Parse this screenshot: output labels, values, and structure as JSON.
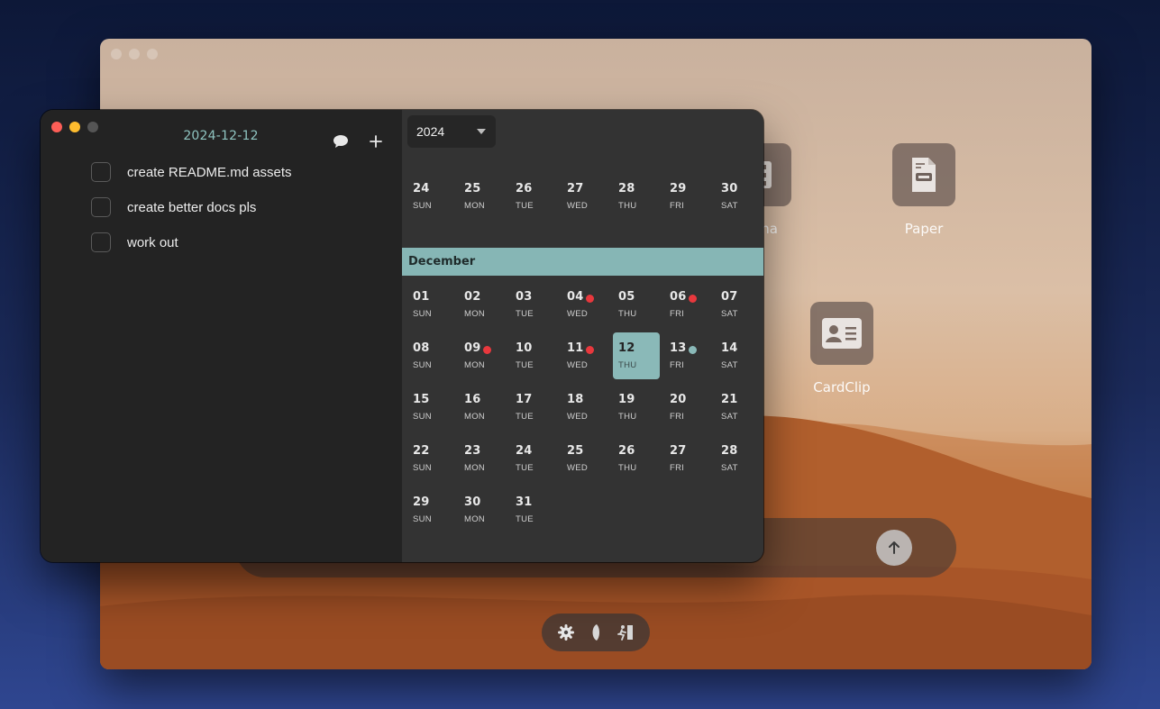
{
  "desktop": {
    "apps": [
      {
        "name": "Cinema",
        "label": "ma",
        "icon": "film-icon"
      },
      {
        "name": "Paper",
        "label": "Paper",
        "icon": "document-icon"
      },
      {
        "name": "CardClip",
        "label": "CardClip",
        "icon": "contact-card-icon"
      }
    ],
    "dock": [
      "gear-icon",
      "moon-icon",
      "exit-icon"
    ],
    "send_icon": "arrow-up-icon"
  },
  "todo": {
    "date": "2024-12-12",
    "items": [
      {
        "text": "create README.md assets",
        "done": false
      },
      {
        "text": "create better docs pls",
        "done": false
      },
      {
        "text": "work out",
        "done": false
      }
    ]
  },
  "calendar": {
    "year": "2024",
    "prev_week": [
      {
        "num": "24",
        "wd": "SUN"
      },
      {
        "num": "25",
        "wd": "MON"
      },
      {
        "num": "26",
        "wd": "TUE"
      },
      {
        "num": "27",
        "wd": "WED"
      },
      {
        "num": "28",
        "wd": "THU"
      },
      {
        "num": "29",
        "wd": "FRI"
      },
      {
        "num": "30",
        "wd": "SAT"
      }
    ],
    "month": "December",
    "weeks": [
      [
        {
          "num": "01",
          "wd": "SUN"
        },
        {
          "num": "02",
          "wd": "MON"
        },
        {
          "num": "03",
          "wd": "TUE"
        },
        {
          "num": "04",
          "wd": "WED",
          "dot": "#e8383d"
        },
        {
          "num": "05",
          "wd": "THU"
        },
        {
          "num": "06",
          "wd": "FRI",
          "dot": "#e8383d"
        },
        {
          "num": "07",
          "wd": "SAT"
        }
      ],
      [
        {
          "num": "08",
          "wd": "SUN"
        },
        {
          "num": "09",
          "wd": "MON",
          "dot": "#e8383d"
        },
        {
          "num": "10",
          "wd": "TUE"
        },
        {
          "num": "11",
          "wd": "WED",
          "dot": "#e8383d"
        },
        {
          "num": "12",
          "wd": "THU",
          "selected": true
        },
        {
          "num": "13",
          "wd": "FRI",
          "dot": "#8ab9b8"
        },
        {
          "num": "14",
          "wd": "SAT"
        }
      ],
      [
        {
          "num": "15",
          "wd": "SUN"
        },
        {
          "num": "16",
          "wd": "MON"
        },
        {
          "num": "17",
          "wd": "TUE"
        },
        {
          "num": "18",
          "wd": "WED"
        },
        {
          "num": "19",
          "wd": "THU"
        },
        {
          "num": "20",
          "wd": "FRI"
        },
        {
          "num": "21",
          "wd": "SAT"
        }
      ],
      [
        {
          "num": "22",
          "wd": "SUN"
        },
        {
          "num": "23",
          "wd": "MON"
        },
        {
          "num": "24",
          "wd": "TUE"
        },
        {
          "num": "25",
          "wd": "WED"
        },
        {
          "num": "26",
          "wd": "THU"
        },
        {
          "num": "27",
          "wd": "FRI"
        },
        {
          "num": "28",
          "wd": "SAT"
        }
      ],
      [
        {
          "num": "29",
          "wd": "SUN"
        },
        {
          "num": "30",
          "wd": "MON"
        },
        {
          "num": "31",
          "wd": "TUE"
        }
      ]
    ]
  },
  "colors": {
    "accent": "#8ab9b8",
    "event_dot": "#e8383d"
  }
}
